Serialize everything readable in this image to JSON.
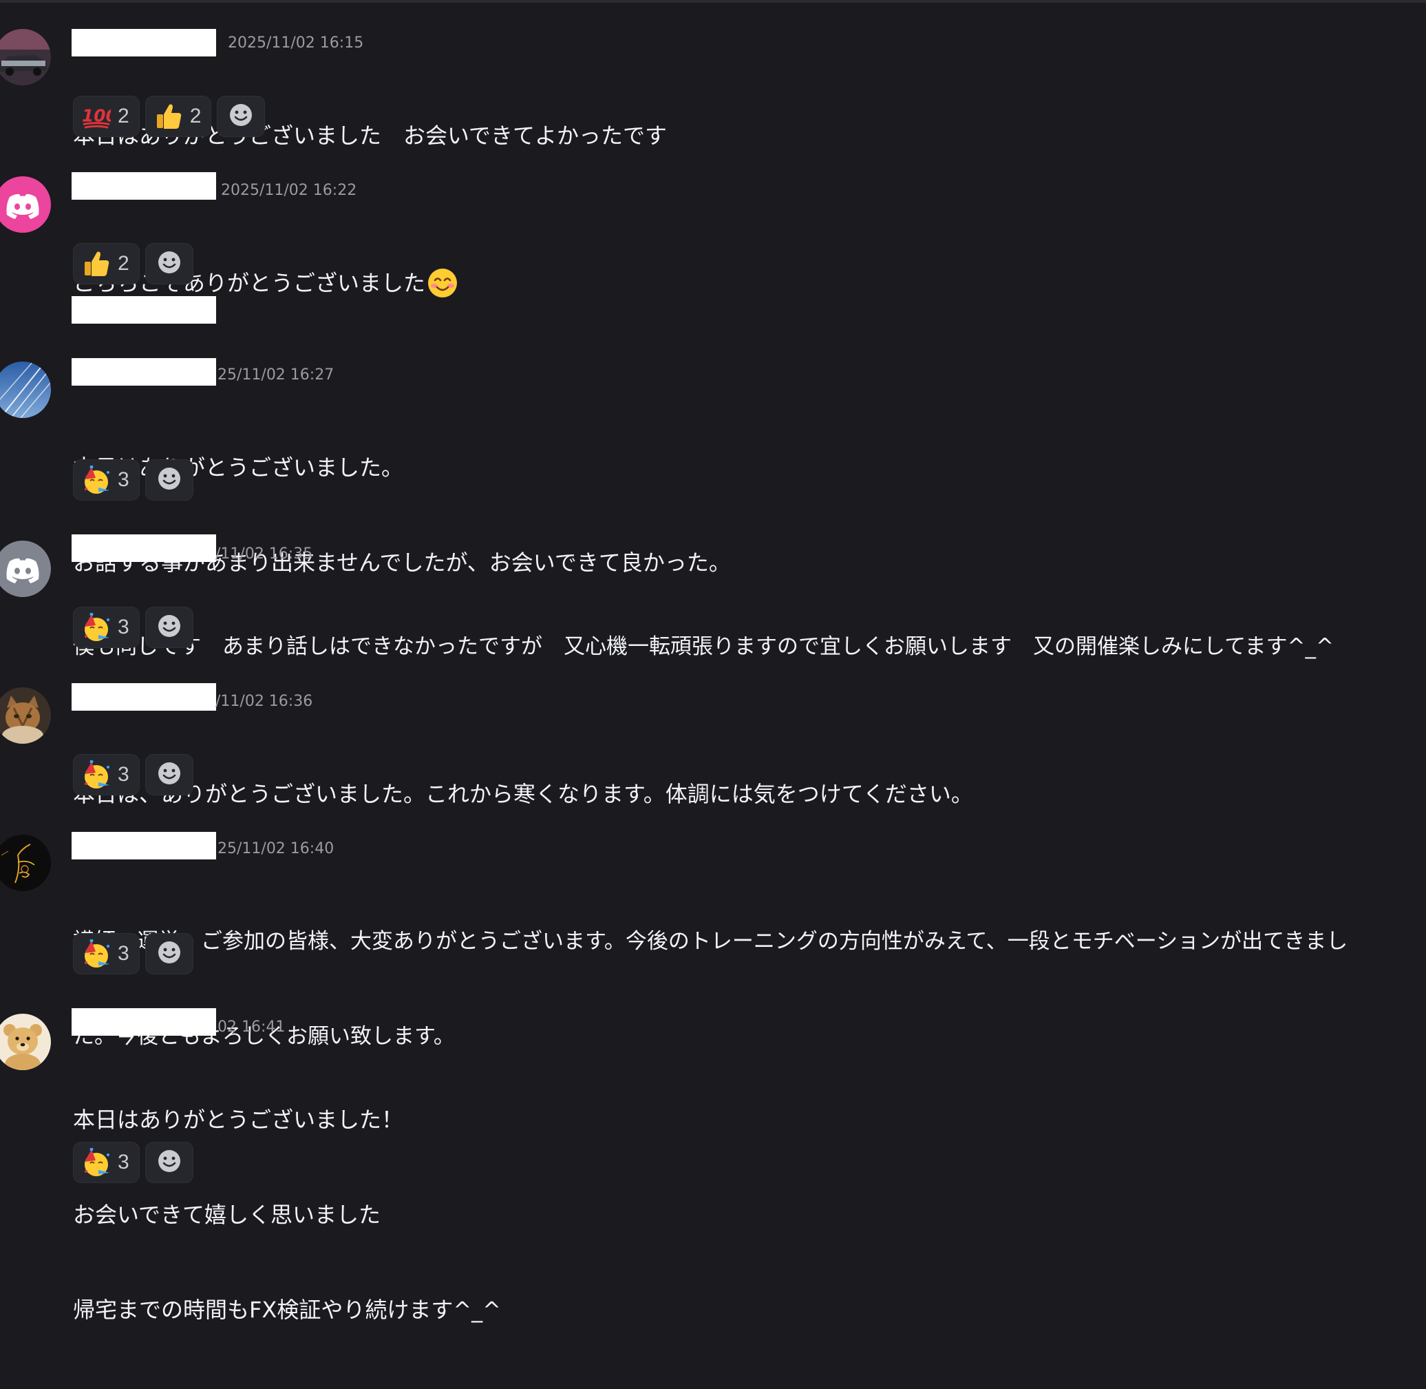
{
  "messages": [
    {
      "avatar": "car-avatar",
      "timestamp": "2025/11/02 16:15",
      "lines": [
        "本日はありがとうございました　お会いできてよかったです"
      ],
      "reactions": [
        {
          "emoji": "hundred-points-icon",
          "count": "2"
        },
        {
          "emoji": "thumbs-up-icon",
          "count": "2"
        }
      ]
    },
    {
      "avatar": "discord-pink-avatar",
      "timestamp": "2025/11/02 16:22",
      "lines": [
        "こちらこそありがとうございました"
      ],
      "trailing_emoji": "smiling-face-icon",
      "reactions": [
        {
          "emoji": "thumbs-up-icon",
          "count": "2"
        }
      ]
    },
    {
      "avatar": "sky-avatar",
      "timestamp": "25/11/02 16:27",
      "lines": [
        "本日はありがとうございました。",
        "お話する事があまり出来ませんでしたが、お会いできて良かった。"
      ],
      "reactions": [
        {
          "emoji": "partying-face-icon",
          "count": "3"
        }
      ]
    },
    {
      "avatar": "discord-grey-avatar",
      "timestamp": "/11/02 16:35",
      "lines": [
        "僕も同じです　あまり話しはできなかったですが　又心機一転頑張りますので宜しくお願いします　又の開催楽しみにしてます^_^"
      ],
      "reactions": [
        {
          "emoji": "partying-face-icon",
          "count": "3"
        }
      ]
    },
    {
      "avatar": "cat-avatar",
      "timestamp": "/11/02 16:36",
      "lines": [
        "本日は、ありがとうございました。これから寒くなります。体調には気をつけてください。"
      ],
      "reactions": [
        {
          "emoji": "partying-face-icon",
          "count": "3"
        }
      ]
    },
    {
      "avatar": "fireworks-avatar",
      "timestamp": "25/11/02 16:40",
      "lines": [
        "講師、運営、ご参加の皆様、大変ありがとうございます。今後のトレーニングの方向性がみえて、一段とモチベーションが出てきまし",
        "た。今後ともよろしくお願い致します。"
      ],
      "reactions": [
        {
          "emoji": "partying-face-icon",
          "count": "3"
        }
      ]
    },
    {
      "avatar": "teddy-bear-avatar",
      "timestamp": "02 16:41",
      "lines": [
        "本日はありがとうございました！",
        "お会いできて嬉しく思いました",
        "帰宅までの時間もFX検証やり続けます^_^"
      ],
      "reactions": [
        {
          "emoji": "partying-face-icon",
          "count": "3"
        }
      ]
    }
  ]
}
